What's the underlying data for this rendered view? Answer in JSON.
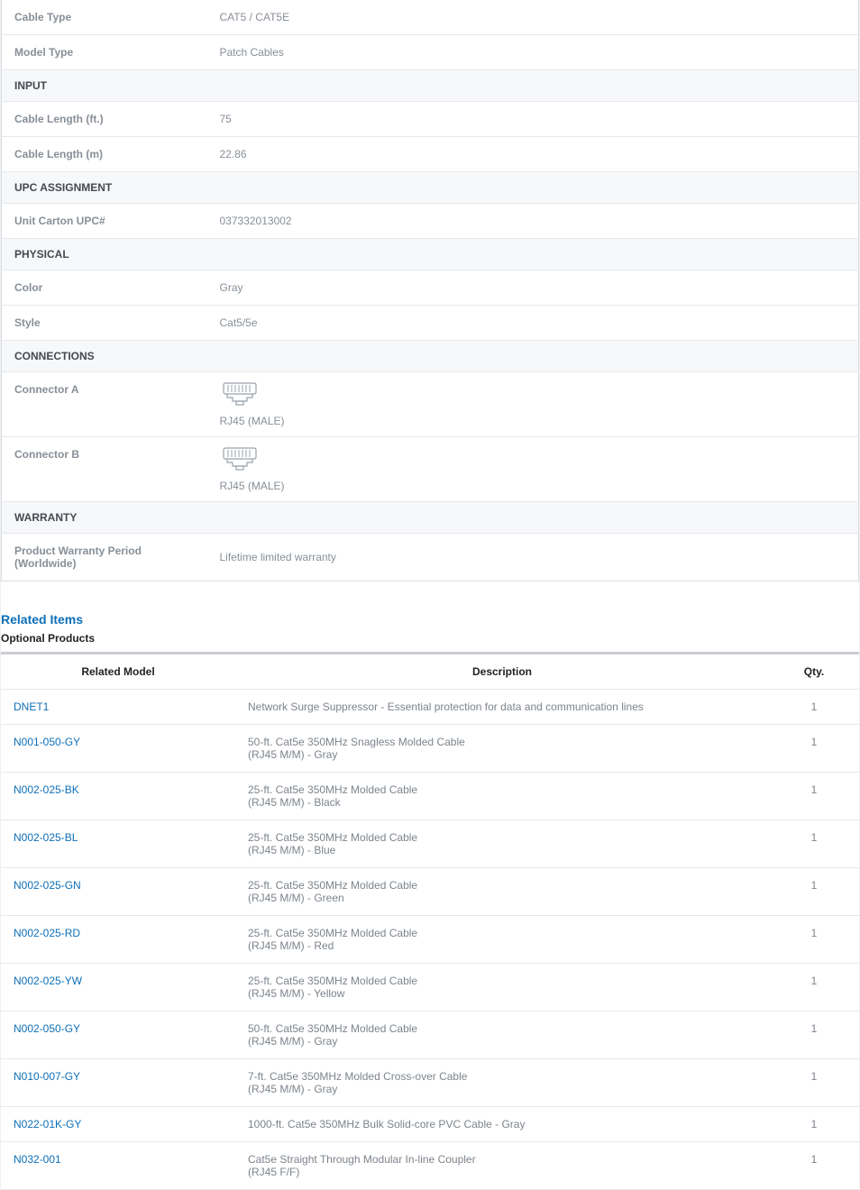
{
  "specs": {
    "cable_type": {
      "label": "Cable Type",
      "value": "CAT5 / CAT5E"
    },
    "model_type": {
      "label": "Model Type",
      "value": "Patch Cables"
    },
    "input_header": "INPUT",
    "cable_length_ft": {
      "label": "Cable Length (ft.)",
      "value": "75"
    },
    "cable_length_m": {
      "label": "Cable Length (m)",
      "value": "22.86"
    },
    "upc_header": "UPC ASSIGNMENT",
    "unit_carton_upc": {
      "label": "Unit Carton UPC#",
      "value": "037332013002"
    },
    "physical_header": "PHYSICAL",
    "color": {
      "label": "Color",
      "value": "Gray"
    },
    "style": {
      "label": "Style",
      "value": "Cat5/5e"
    },
    "connections_header": "CONNECTIONS",
    "connector_a": {
      "label": "Connector A",
      "value": "RJ45 (MALE)"
    },
    "connector_b": {
      "label": "Connector B",
      "value": "RJ45 (MALE)"
    },
    "warranty_header": "WARRANTY",
    "warranty_period": {
      "label": "Product Warranty Period (Worldwide)",
      "value": "Lifetime limited warranty"
    }
  },
  "related": {
    "heading": "Related Items",
    "subheading": "Optional Products",
    "columns": {
      "model": "Related Model",
      "description": "Description",
      "qty": "Qty."
    },
    "items": [
      {
        "model": "DNET1",
        "description": "Network Surge Suppressor - Essential protection for data and communication lines",
        "qty": "1"
      },
      {
        "model": "N001-050-GY",
        "description": "50-ft. Cat5e 350MHz Snagless Molded Cable\n(RJ45 M/M) - Gray",
        "qty": "1"
      },
      {
        "model": "N002-025-BK",
        "description": "25-ft. Cat5e 350MHz Molded Cable\n(RJ45 M/M) - Black",
        "qty": "1"
      },
      {
        "model": "N002-025-BL",
        "description": "25-ft. Cat5e 350MHz Molded Cable\n(RJ45 M/M) - Blue",
        "qty": "1"
      },
      {
        "model": "N002-025-GN",
        "description": "25-ft. Cat5e 350MHz Molded Cable\n(RJ45 M/M) - Green",
        "qty": "1"
      },
      {
        "model": "N002-025-RD",
        "description": "25-ft. Cat5e 350MHz Molded Cable\n(RJ45 M/M) - Red",
        "qty": "1"
      },
      {
        "model": "N002-025-YW",
        "description": "25-ft. Cat5e 350MHz Molded Cable\n(RJ45 M/M) - Yellow",
        "qty": "1"
      },
      {
        "model": "N002-050-GY",
        "description": "50-ft. Cat5e 350MHz Molded Cable\n(RJ45 M/M) - Gray",
        "qty": "1"
      },
      {
        "model": "N010-007-GY",
        "description": "7-ft. Cat5e 350MHz Molded Cross-over Cable\n(RJ45 M/M) - Gray",
        "qty": "1"
      },
      {
        "model": "N022-01K-GY",
        "description": "1000-ft. Cat5e 350MHz Bulk Solid-core PVC Cable - Gray",
        "qty": "1"
      },
      {
        "model": "N032-001",
        "description": "Cat5e Straight Through Modular In-line Coupler\n(RJ45 F/F)",
        "qty": "1"
      }
    ]
  }
}
